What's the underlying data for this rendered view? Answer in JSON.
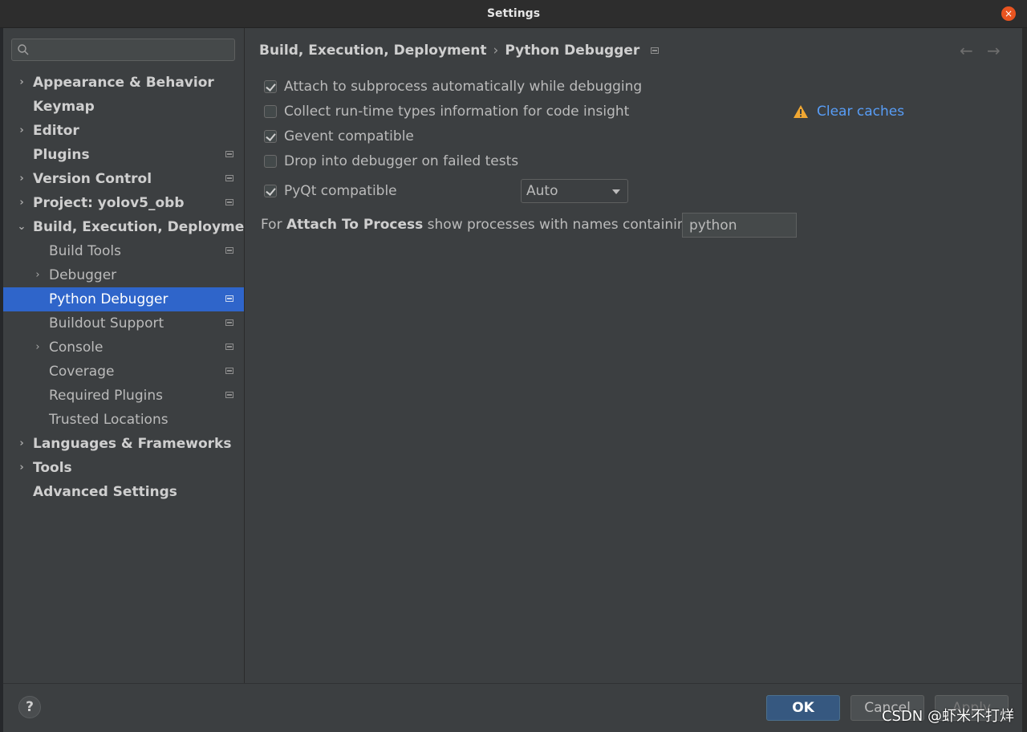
{
  "window": {
    "title": "Settings",
    "close_icon": "×"
  },
  "sidebar": {
    "search": {
      "placeholder": ""
    },
    "items": [
      {
        "label": "Appearance & Behavior",
        "level": 0,
        "bold": true,
        "arrow": "›",
        "icon": false
      },
      {
        "label": "Keymap",
        "level": 0,
        "bold": true,
        "arrow": "",
        "icon": false
      },
      {
        "label": "Editor",
        "level": 0,
        "bold": true,
        "arrow": "›",
        "icon": false
      },
      {
        "label": "Plugins",
        "level": 0,
        "bold": true,
        "arrow": "",
        "icon": true
      },
      {
        "label": "Version Control",
        "level": 0,
        "bold": true,
        "arrow": "›",
        "icon": true
      },
      {
        "label": "Project: yolov5_obb",
        "level": 0,
        "bold": true,
        "arrow": "›",
        "icon": true
      },
      {
        "label": "Build, Execution, Deployment",
        "level": 0,
        "bold": true,
        "arrow": "⌄",
        "icon": false
      },
      {
        "label": "Build Tools",
        "level": 1,
        "bold": false,
        "arrow": "",
        "icon": true
      },
      {
        "label": "Debugger",
        "level": 1,
        "bold": false,
        "arrow": "›",
        "icon": false
      },
      {
        "label": "Python Debugger",
        "level": 1,
        "bold": false,
        "arrow": "",
        "icon": true,
        "selected": true
      },
      {
        "label": "Buildout Support",
        "level": 1,
        "bold": false,
        "arrow": "",
        "icon": true
      },
      {
        "label": "Console",
        "level": 1,
        "bold": false,
        "arrow": "›",
        "icon": true
      },
      {
        "label": "Coverage",
        "level": 1,
        "bold": false,
        "arrow": "",
        "icon": true
      },
      {
        "label": "Required Plugins",
        "level": 1,
        "bold": false,
        "arrow": "",
        "icon": true
      },
      {
        "label": "Trusted Locations",
        "level": 1,
        "bold": false,
        "arrow": "",
        "icon": false
      },
      {
        "label": "Languages & Frameworks",
        "level": 0,
        "bold": true,
        "arrow": "›",
        "icon": false
      },
      {
        "label": "Tools",
        "level": 0,
        "bold": true,
        "arrow": "›",
        "icon": false
      },
      {
        "label": "Advanced Settings",
        "level": 0,
        "bold": true,
        "arrow": "",
        "icon": false
      }
    ]
  },
  "breadcrumb": {
    "parent": "Build, Execution, Deployment",
    "separator": "›",
    "current": "Python Debugger"
  },
  "nav": {
    "back": "←",
    "forward": "→"
  },
  "options": {
    "attach_subprocess": {
      "label": "Attach to subprocess automatically while debugging",
      "checked": true
    },
    "collect_types": {
      "label": "Collect run-time types information for code insight",
      "checked": false
    },
    "gevent": {
      "label": "Gevent compatible",
      "checked": true
    },
    "drop_into_debugger": {
      "label": "Drop into debugger on failed tests",
      "checked": false
    },
    "pyqt": {
      "label": "PyQt compatible",
      "checked": true
    }
  },
  "clear_caches": {
    "label": "Clear caches",
    "warning_color": "#f0a732"
  },
  "pyqt_select": {
    "value": "Auto"
  },
  "attach_process": {
    "prefix": "For ",
    "bold": "Attach To Process",
    "suffix": " show processes with names containing:",
    "value": "python"
  },
  "footer": {
    "help": "?",
    "ok": "OK",
    "cancel": "Cancel",
    "apply": "Apply"
  },
  "watermark": "CSDN @虾米不打烊",
  "colors": {
    "accent": "#2f65ca",
    "ok_button": "#365880",
    "link": "#589df6"
  }
}
